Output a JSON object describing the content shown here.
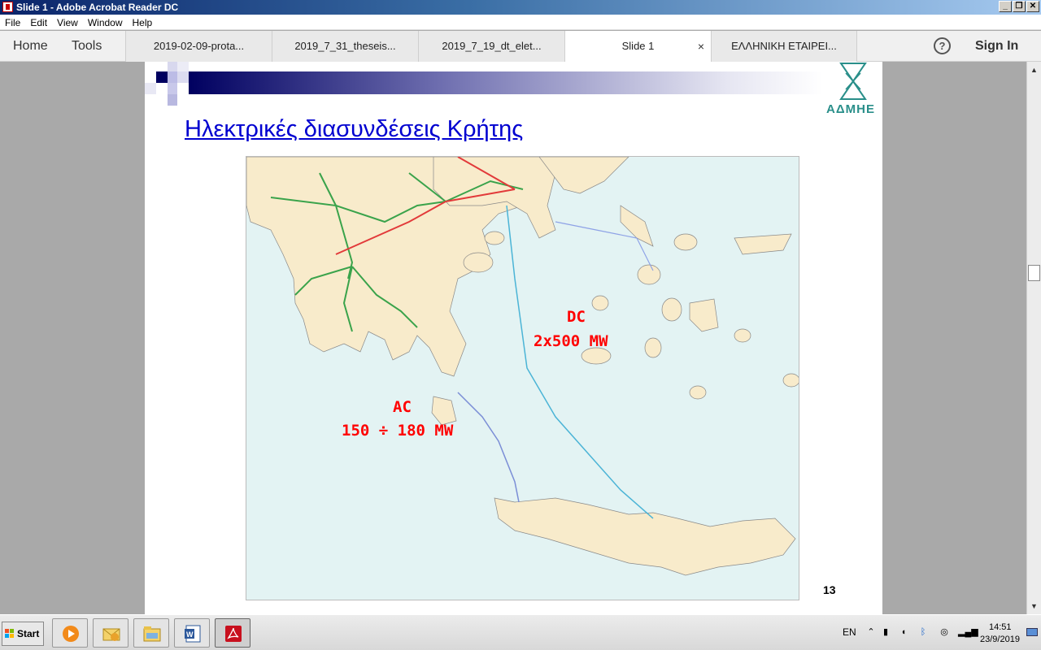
{
  "window": {
    "title": "Slide 1 - Adobe Acrobat Reader DC"
  },
  "menu": [
    "File",
    "Edit",
    "View",
    "Window",
    "Help"
  ],
  "nav": {
    "home": "Home",
    "tools": "Tools"
  },
  "tabs": [
    {
      "label": "2019-02-09-prota..."
    },
    {
      "label": "2019_7_31_theseis..."
    },
    {
      "label": "2019_7_19_dt_elet..."
    },
    {
      "label": "Slide 1",
      "active": true,
      "close": "×"
    },
    {
      "label": "ΕΛΛΗΝΙΚΗ ΕΤΑΙΡΕΙ..."
    }
  ],
  "help": "?",
  "sign_in": "Sign In",
  "slide": {
    "title": "Ηλεκτρικές διασυνδέσεις Κρήτης",
    "logo_text": "ΑΔΜΗΕ",
    "dc_label_1": "DC",
    "dc_label_2": "2x500 MW",
    "ac_label_1": "AC",
    "ac_label_2": "150 ÷ 180 MW",
    "page_number": "13"
  },
  "taskbar": {
    "start": "Start",
    "apps": [
      "media-player-icon",
      "outlook-icon",
      "explorer-icon",
      "word-icon",
      "acrobat-icon"
    ],
    "lang": "EN",
    "time": "14:51",
    "date": "23/9/2019"
  },
  "colors": {
    "title_link": "#0000d0",
    "map_labels": "#ff0000",
    "sea": "#e3f3f3",
    "land": "#f8ebcb"
  }
}
